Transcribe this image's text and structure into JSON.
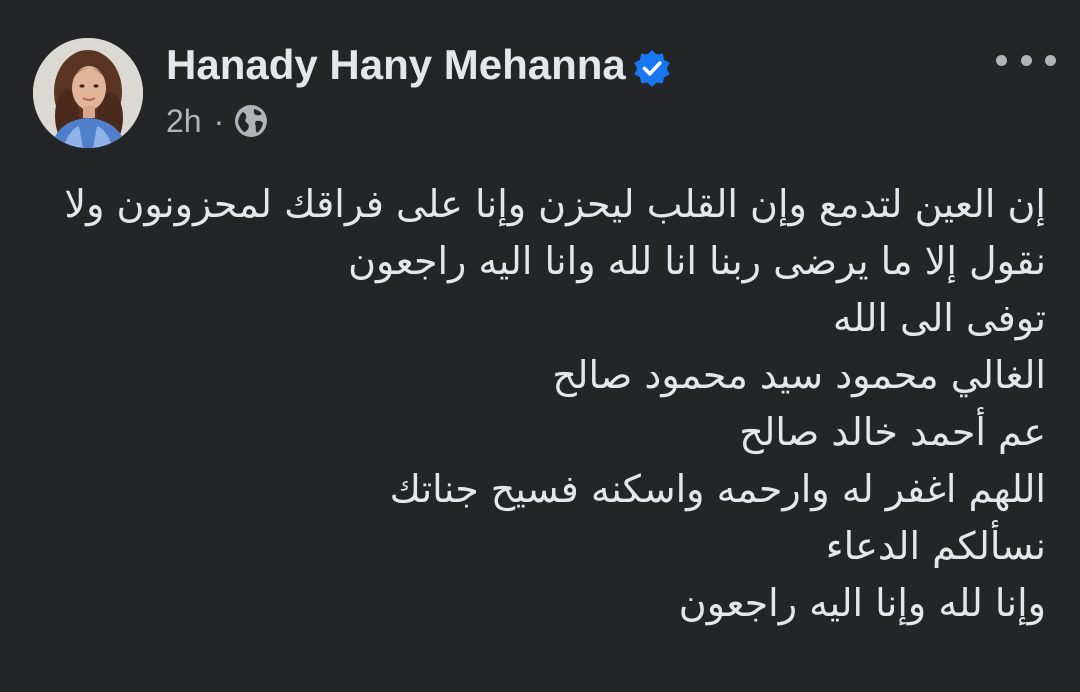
{
  "post": {
    "author": {
      "name": "Hanady Hany Mehanna",
      "verified": true,
      "avatar_icon": "profile-photo"
    },
    "timestamp": "2h",
    "separator": "·",
    "audience_icon": "globe-icon",
    "more_icon": "more-options-icon",
    "body_lines": [
      "إن العين لتدمع وإن القلب ليحزن وإنا على فراقك لمحزونون ولا",
      "نقول إلا ما يرضى ربنا  انا لله وانا اليه راجعون",
      "توفى الى الله",
      "الغالي محمود سيد محمود صالح",
      "عم أحمد خالد صالح",
      "اللهم اغفر له وارحمه واسكنه فسيح جناتك",
      "نسألكم الدعاء",
      "وإنا لله وإنا اليه راجعون"
    ]
  },
  "colors": {
    "background": "#242526",
    "primary_text": "#e4e6eb",
    "secondary_text": "#b0b3b8",
    "verified_badge": "#1877f2"
  }
}
